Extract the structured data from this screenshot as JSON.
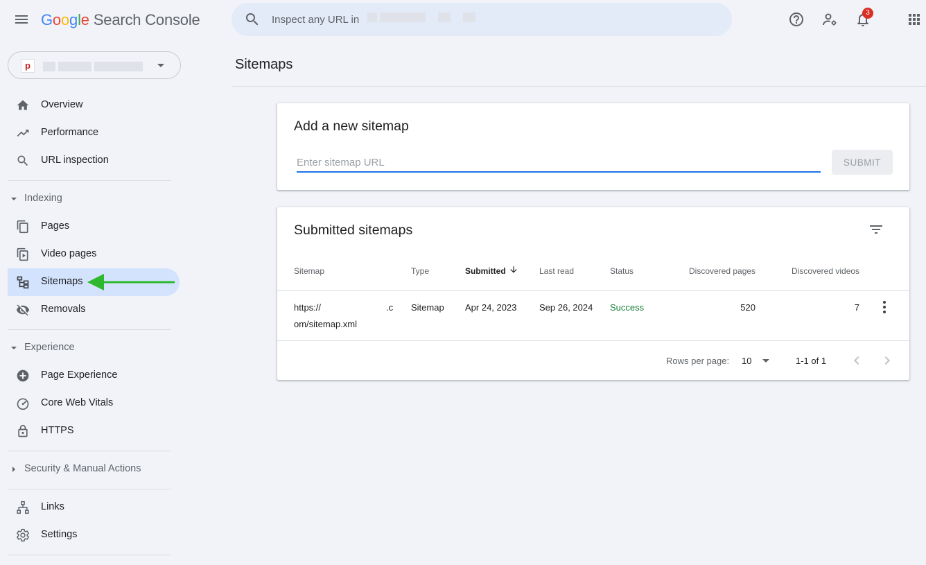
{
  "topbar": {
    "logo_letters": [
      "G",
      "o",
      "o",
      "g",
      "l",
      "e"
    ],
    "product_name": "Search Console",
    "search_placeholder": "Inspect any URL in",
    "notification_count": "3"
  },
  "property": {
    "favicon_letter": "p"
  },
  "sidebar": {
    "top_items": [
      {
        "label": "Overview",
        "icon": "home-icon"
      },
      {
        "label": "Performance",
        "icon": "trending-up-icon"
      },
      {
        "label": "URL inspection",
        "icon": "search-icon"
      }
    ],
    "indexing": {
      "title": "Indexing",
      "items": [
        {
          "label": "Pages",
          "icon": "pages-icon"
        },
        {
          "label": "Video pages",
          "icon": "video-pages-icon"
        },
        {
          "label": "Sitemaps",
          "icon": "sitemap-icon",
          "active": true
        },
        {
          "label": "Removals",
          "icon": "removals-icon"
        }
      ]
    },
    "experience": {
      "title": "Experience",
      "items": [
        {
          "label": "Page Experience",
          "icon": "page-experience-icon"
        },
        {
          "label": "Core Web Vitals",
          "icon": "gauge-icon"
        },
        {
          "label": "HTTPS",
          "icon": "lock-icon"
        }
      ]
    },
    "security": {
      "title": "Security & Manual Actions"
    },
    "bottom_items": [
      {
        "label": "Links",
        "icon": "links-icon"
      },
      {
        "label": "Settings",
        "icon": "gear-icon"
      }
    ]
  },
  "main": {
    "page_title": "Sitemaps",
    "add_card": {
      "title": "Add a new sitemap",
      "input_placeholder": "Enter sitemap URL",
      "input_value": "",
      "submit_label": "SUBMIT"
    },
    "submitted_card": {
      "title": "Submitted sitemaps",
      "columns": [
        "Sitemap",
        "Type",
        "Submitted",
        "Last read",
        "Status",
        "Discovered pages",
        "Discovered videos"
      ],
      "rows": [
        {
          "sitemap_line1_start": "https://",
          "sitemap_line1_end": ".c",
          "sitemap_line2": "om/sitemap.xml",
          "type": "Sitemap",
          "submitted": "Apr 24, 2023",
          "last_read": "Sep 26, 2024",
          "status": "Success",
          "discovered_pages": "520",
          "discovered_videos": "7"
        }
      ],
      "footer": {
        "rows_per_page_label": "Rows per page:",
        "rows_per_page_value": "10",
        "range": "1-1 of 1"
      }
    }
  },
  "colors": {
    "accent": "#1a73e8",
    "active_nav": "#d3e3fd",
    "success": "#188038",
    "arrow": "#2db82d",
    "badge": "#d93025"
  }
}
